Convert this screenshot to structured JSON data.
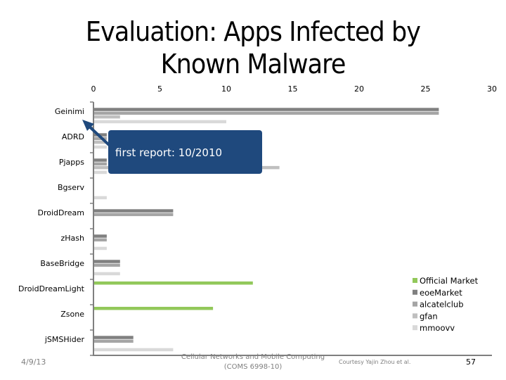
{
  "slide": {
    "title": "Evaluation: Apps Infected by Known Malware",
    "footer": {
      "date": "4/9/13",
      "course_line1": "Cellular Networks and Mobile Computing",
      "course_line2": "(COMS 6998-10)",
      "courtesy": "Courtesy Yajin Zhou et al.",
      "page_number": "57"
    }
  },
  "chart_data": {
    "type": "bar",
    "orientation": "horizontal",
    "title": "",
    "xlabel": "",
    "ylabel": "",
    "xlim": [
      0,
      30
    ],
    "x_ticks": [
      "0",
      "5",
      "10",
      "15",
      "20",
      "25",
      "30"
    ],
    "x_tick_values": [
      0,
      5,
      10,
      15,
      20,
      25,
      30
    ],
    "x_axis_position": "top",
    "grid": false,
    "legend_position": "right",
    "categories": [
      "Geinimi",
      "ADRD",
      "Pjapps",
      "Bgserv",
      "DroidDream",
      "zHash",
      "BaseBridge",
      "DroidDreamLight",
      "Zsone",
      "jSMSHider"
    ],
    "series": [
      {
        "name": "Official Market",
        "color": "#92c85a",
        "values": [
          0,
          0,
          0,
          0,
          0,
          0,
          0,
          12,
          9,
          0
        ]
      },
      {
        "name": "eoeMarket",
        "color": "#808080",
        "values": [
          26,
          1,
          1,
          0,
          6,
          1,
          2,
          0,
          0,
          3
        ]
      },
      {
        "name": "alcatelclub",
        "color": "#a5a5a5",
        "values": [
          26,
          1,
          1,
          0,
          6,
          1,
          2,
          0,
          0,
          3
        ]
      },
      {
        "name": "gfan",
        "color": "#bfbfbf",
        "values": [
          2,
          1,
          14,
          0,
          0,
          0,
          0,
          0,
          0,
          0
        ]
      },
      {
        "name": "mmoovv",
        "color": "#d9d9d9",
        "values": [
          10,
          1,
          1,
          1,
          0,
          1,
          2,
          0,
          0,
          6
        ]
      }
    ],
    "annotations": [
      {
        "text": "first report: 10/2010",
        "points_to": "Geinimi",
        "style": "callout-with-arrow",
        "color": "#1f497d"
      }
    ]
  }
}
